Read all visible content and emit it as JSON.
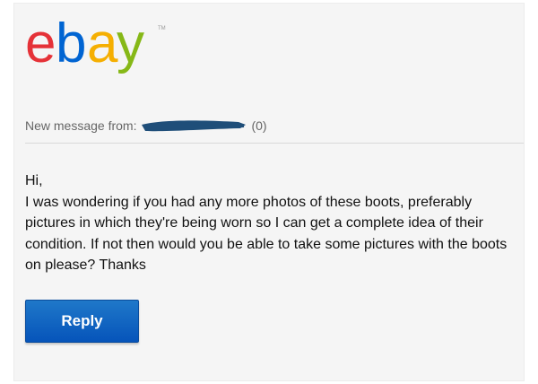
{
  "brand": {
    "logo_text": "ebay",
    "trademark": "TM",
    "letters": [
      {
        "char": "e",
        "color": "#e53238"
      },
      {
        "char": "b",
        "color": "#0064d2"
      },
      {
        "char": "a",
        "color": "#f5af02"
      },
      {
        "char": "y",
        "color": "#86b817"
      }
    ]
  },
  "header": {
    "from_label": "New message from:",
    "sender_name_redacted": true,
    "feedback_score": "(0)"
  },
  "message": {
    "greeting": "Hi,",
    "body": "I was wondering if you had any more photos of these boots, preferably pictures in which they're being worn so I can get a complete idea of their condition. If not then would you be able to take some pictures with the boots on please? Thanks"
  },
  "actions": {
    "reply_label": "Reply"
  },
  "colors": {
    "reply_button": "#0654ba",
    "redaction": "#1f4e79"
  }
}
